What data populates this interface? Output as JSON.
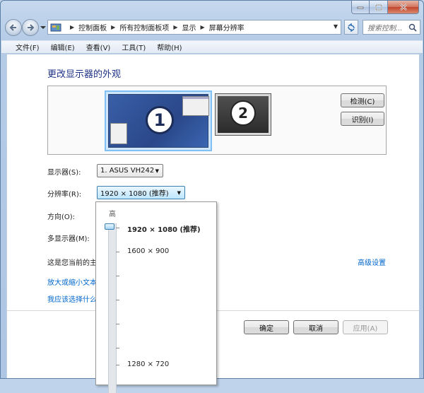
{
  "breadcrumb": [
    "控制面板",
    "所有控制面板项",
    "显示",
    "屏幕分辨率"
  ],
  "search": {
    "placeholder": "搜索控制..."
  },
  "menu": [
    "文件(F)",
    "编辑(E)",
    "查看(V)",
    "工具(T)",
    "帮助(H)"
  ],
  "page": {
    "title": "更改显示器的外观",
    "detect_label": "检测(C)",
    "identify_label": "识别(I)",
    "monitor1_number": "1",
    "monitor2_number": "2"
  },
  "form": {
    "display_label": "显示器(S):",
    "display_value": "1. ASUS VH242",
    "resolution_label": "分辨率(R):",
    "resolution_value": "1920 × 1080 (推荐)",
    "orientation_label": "方向(O):",
    "multi_label": "多显示器(M):",
    "current_text": "这是您当前的主",
    "advanced_link": "高级设置",
    "link_text_size": "放大或缩小文本",
    "link_which": "我应该选择什么"
  },
  "dropdown": {
    "high_label": "高",
    "options": [
      "1920 × 1080 (推荐)",
      "1600 × 900",
      "1280 × 720"
    ],
    "selected": "1920 × 1080 (推荐)"
  },
  "buttons": {
    "ok": "确定",
    "cancel": "取消",
    "apply": "应用(A)"
  },
  "colors": {
    "title": "#1e3287",
    "link": "#0066cc",
    "selection_border": "#7fc0f5"
  }
}
